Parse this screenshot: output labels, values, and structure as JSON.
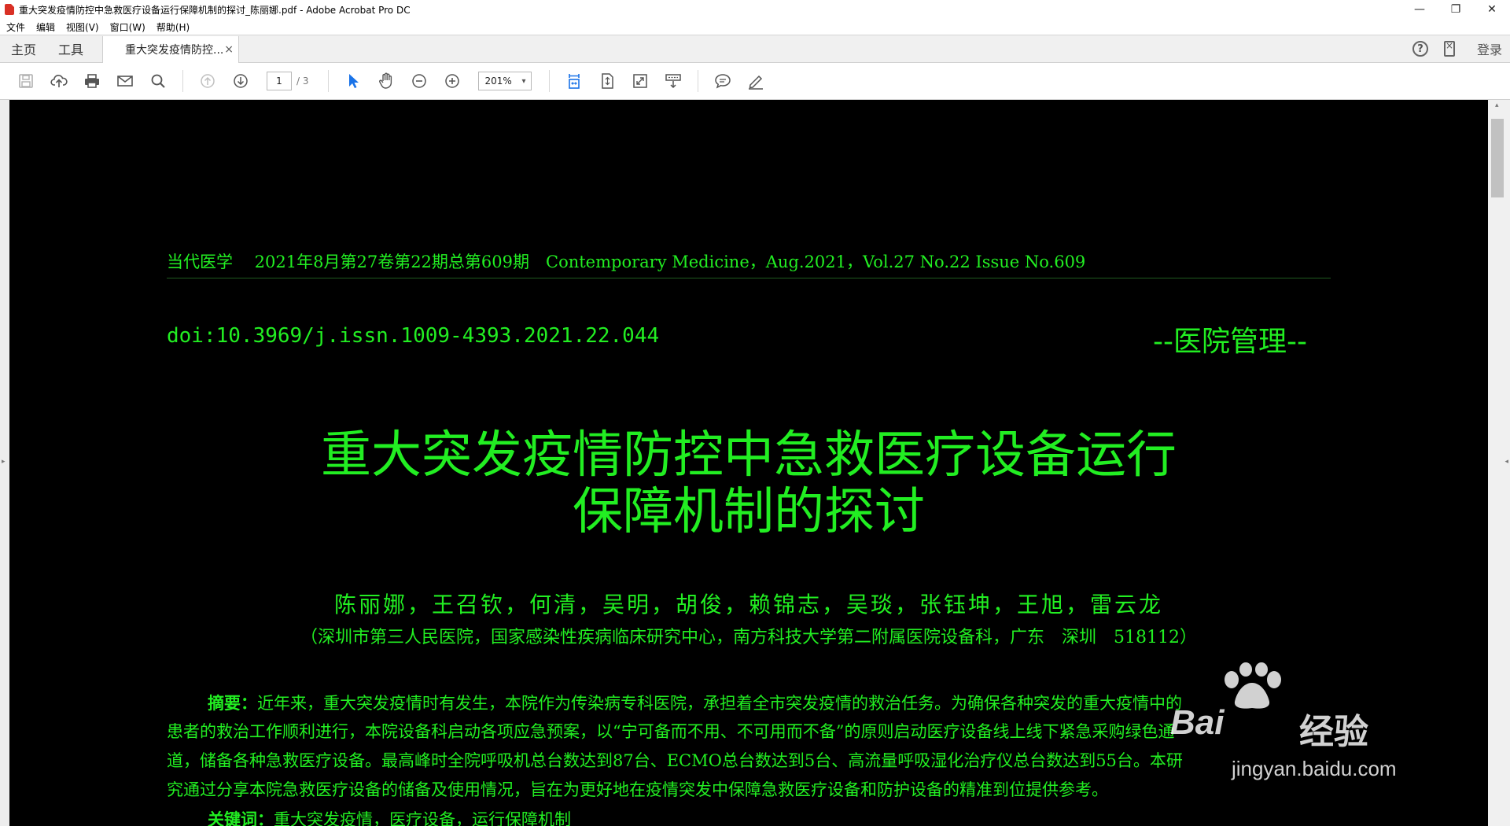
{
  "window": {
    "title": "重大突发疫情防控中急救医疗设备运行保障机制的探讨_陈丽娜.pdf - Adobe Acrobat Pro DC",
    "minimize": "—",
    "restore": "❐",
    "close": "✕"
  },
  "menu": {
    "items": [
      "文件",
      "编辑",
      "视图(V)",
      "窗口(W)",
      "帮助(H)"
    ]
  },
  "tabs": {
    "home": "主页",
    "tools": "工具",
    "document": "重大突发疫情防控...",
    "close": "×",
    "help": "?",
    "login": "登录"
  },
  "toolbar": {
    "page_current": "1",
    "page_total": "/ 3",
    "zoom": "201%",
    "zoom_arrow": "▾"
  },
  "icons": {
    "save": "save-icon",
    "upload": "upload-icon",
    "print": "print-icon",
    "email": "email-icon",
    "search": "search-icon",
    "prev_page": "prev-page-icon",
    "next_page": "next-page-icon",
    "select": "select-arrow-icon",
    "hand": "hand-icon",
    "zoom_out": "zoom-out-icon",
    "zoom_in": "zoom-in-icon",
    "fit_width": "fit-width-icon",
    "fit_page": "fit-page-icon",
    "full_screen": "full-screen-icon",
    "scroll_mode": "scroll-mode-icon",
    "comment": "comment-icon",
    "sign": "sign-icon"
  },
  "colors": {
    "page_bg": "#000000",
    "text_green": "#22ee22",
    "select_blue": "#1a73e8"
  },
  "paper": {
    "header": "当代医学　 2021年8月第27卷第22期总第609期　Contemporary Medicine，Aug.2021，Vol.27 No.22 Issue No.609",
    "doi": "doi:10.3969/j.issn.1009-4393.2021.22.044",
    "section": "--医院管理--",
    "title_line1": "重大突发疫情防控中急救医疗设备运行",
    "title_line2": "保障机制的探讨",
    "authors": "陈丽娜，王召钦，何清，吴明，胡俊，赖锦志，吴琰，张钰坤，王旭，雷云龙",
    "affiliation": "（深圳市第三人民医院，国家感染性疾病临床研究中心，南方科技大学第二附属医院设备科，广东　深圳　518112）",
    "abstract_label": "摘要：",
    "abstract_lines": [
      "近年来，重大突发疫情时有发生，本院作为传染病专科医院，承担着全市突发疫情的救治任务。为确保各种突发的重大疫情中的",
      "患者的救治工作顺利进行，本院设备科启动各项应急预案，以“宁可备而不用、不可用而不备”的原则启动医疗设备线上线下紧急采购绿色通",
      "道，储备各种急救医疗设备。最高峰时全院呼吸机总台数达到87台、ECMO总台数达到5台、高流量呼吸湿化治疗仪总台数达到55台。本研",
      "究通过分享本院急救医疗设备的储备及使用情况，旨在为更好地在疫情突发中保障急救医疗设备和防护设备的精准到位提供参考。"
    ],
    "keywords_label": "关键词：",
    "keywords": "重大突发疫情，医疗设备，运行保障机制"
  },
  "watermark": {
    "brand_left": "Bai",
    "brand_right": "经验",
    "url": "jingyan.baidu.com"
  }
}
